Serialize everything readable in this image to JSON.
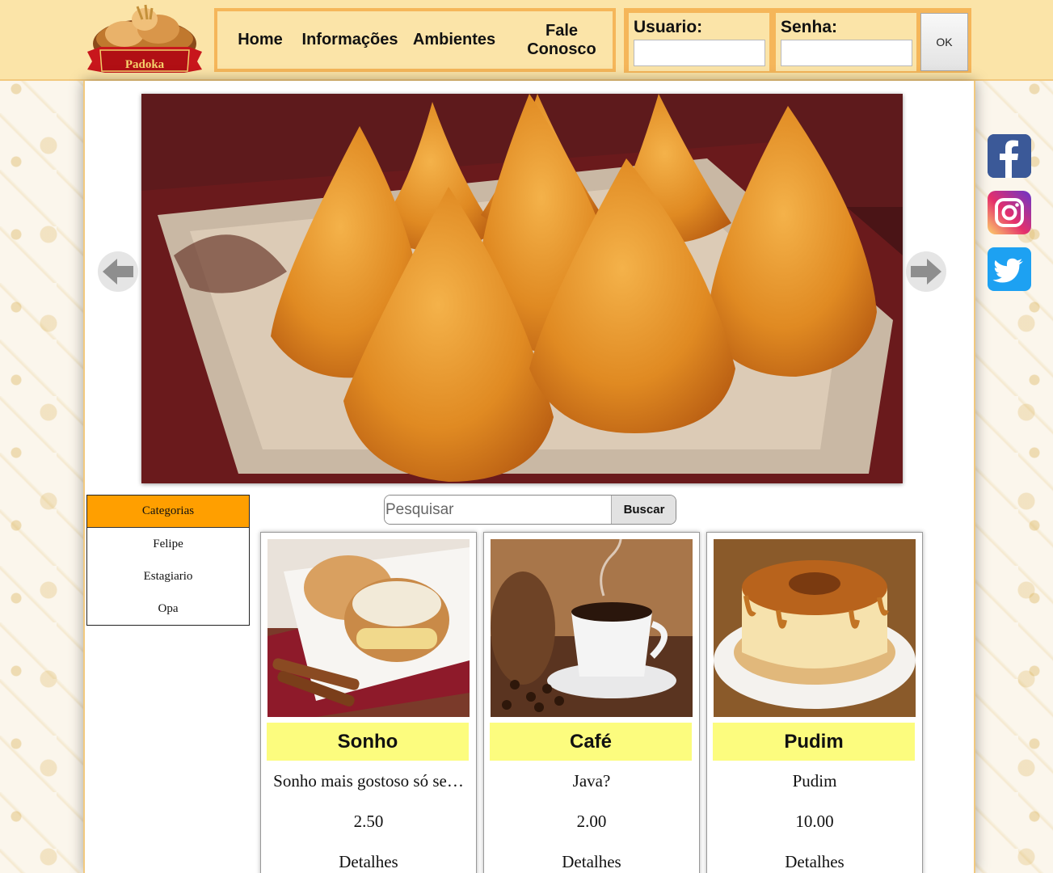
{
  "brand": {
    "logo_text": "Padoka"
  },
  "nav": {
    "items": [
      {
        "label": "Home"
      },
      {
        "label": "Informações"
      },
      {
        "label": "Ambientes"
      },
      {
        "label_line1": "Fale",
        "label_line2": "Conosco"
      }
    ]
  },
  "login": {
    "user_label": "Usuario:",
    "user_value": "",
    "pass_label": "Senha:",
    "pass_value": "",
    "ok_label": "OK"
  },
  "carousel": {
    "image": "coxinha-photo",
    "prev_icon": "arrow-left-icon",
    "next_icon": "arrow-right-icon"
  },
  "categories": {
    "header": "Categorias",
    "items": [
      "Felipe",
      "Estagiario",
      "Opa"
    ],
    "header_color": "#ff9f00"
  },
  "search": {
    "placeholder": "Pesquisar",
    "value": "",
    "button_label": "Buscar"
  },
  "products": [
    {
      "name": "Sonho",
      "description": "Sonho mais gostoso só se…",
      "price": "2.50",
      "details_label": "Detalhes",
      "image": "sonho-photo"
    },
    {
      "name": "Café",
      "description": "Java?",
      "price": "2.00",
      "details_label": "Detalhes",
      "image": "cafe-photo"
    },
    {
      "name": "Pudim",
      "description": "Pudim",
      "price": "10.00",
      "details_label": "Detalhes",
      "image": "pudim-photo"
    }
  ],
  "social": [
    {
      "icon": "facebook-icon",
      "color": "#3b5998"
    },
    {
      "icon": "instagram-icon",
      "color": "#d6249f"
    },
    {
      "icon": "twitter-icon",
      "color": "#1da1f2"
    }
  ],
  "colors": {
    "header_bg": "#fbe4a8",
    "accent_border": "#f5b65a",
    "title_bg": "#fcfc7e"
  }
}
